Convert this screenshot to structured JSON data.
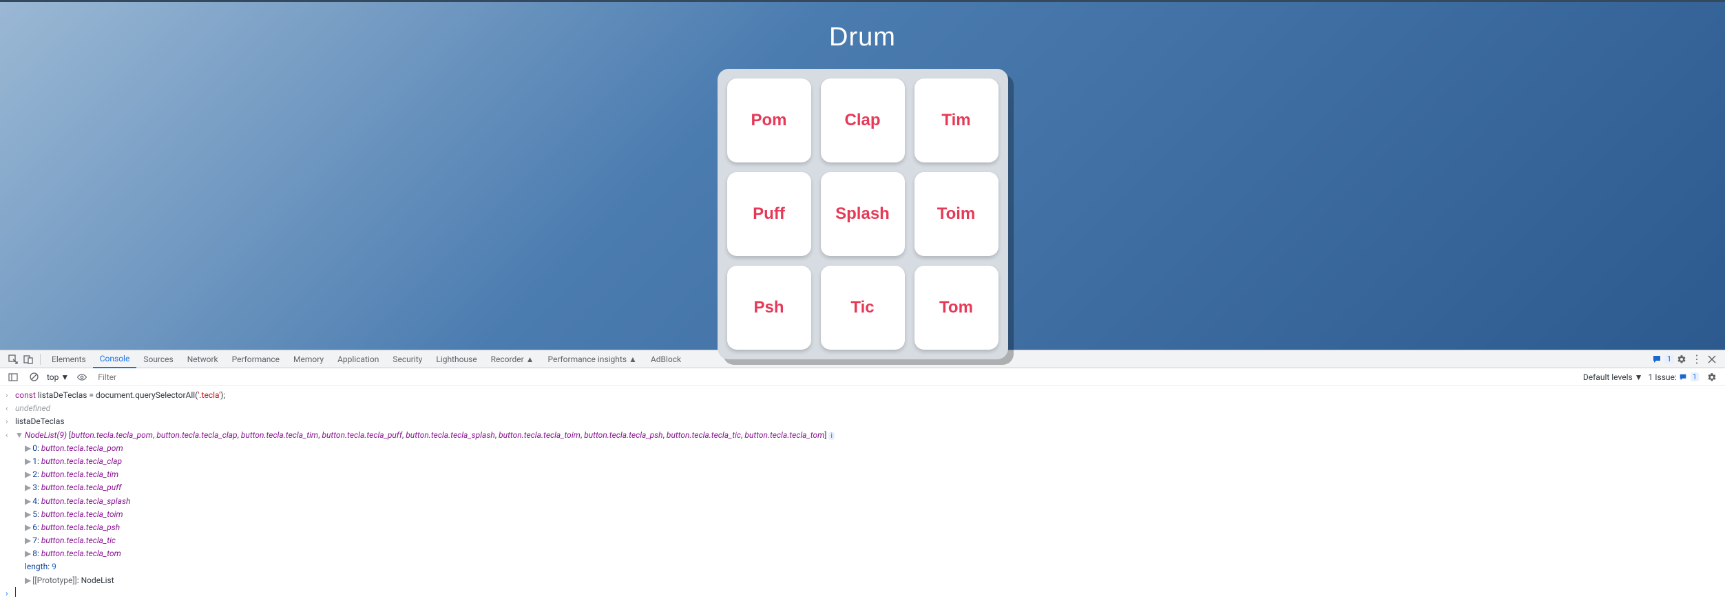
{
  "app": {
    "title": "Drum",
    "buttons": [
      "Pom",
      "Clap",
      "Tim",
      "Puff",
      "Splash",
      "Toim",
      "Psh",
      "Tic",
      "Tom"
    ]
  },
  "devtools": {
    "tabs": [
      "Elements",
      "Console",
      "Sources",
      "Network",
      "Performance",
      "Memory",
      "Application",
      "Security",
      "Lighthouse",
      "Recorder ▲",
      "Performance insights ▲",
      "AdBlock"
    ],
    "active_tab": "Console",
    "right_badge": "1",
    "toolbar": {
      "context": "top ▼",
      "filter_placeholder": "Filter",
      "levels": "Default levels ▼",
      "issue_label": "1 Issue:",
      "issue_badge": "1"
    },
    "console": {
      "input1_pre": "const listaDeTeclas = document.querySelectorAll(",
      "input1_str": "'.tecla'",
      "input1_post": ");",
      "undefined": "undefined",
      "input2": "listaDeTeclas",
      "nodelist_head": "NodeList(9)",
      "nodelist_items_inline": [
        "button.tecla.tecla_pom",
        "button.tecla.tecla_clap",
        "button.tecla.tecla_tim",
        "button.tecla.tecla_puff",
        "button.tecla.tecla_splash",
        "button.tecla.tecla_toim",
        "button.tecla.tecla_psh",
        "button.tecla.tecla_tic",
        "button.tecla.tecla_tom"
      ],
      "expanded": [
        {
          "idx": "0",
          "val": "button.tecla.tecla_pom"
        },
        {
          "idx": "1",
          "val": "button.tecla.tecla_clap"
        },
        {
          "idx": "2",
          "val": "button.tecla.tecla_tim"
        },
        {
          "idx": "3",
          "val": "button.tecla.tecla_puff"
        },
        {
          "idx": "4",
          "val": "button.tecla.tecla_splash"
        },
        {
          "idx": "5",
          "val": "button.tecla.tecla_toim"
        },
        {
          "idx": "6",
          "val": "button.tecla.tecla_psh"
        },
        {
          "idx": "7",
          "val": "button.tecla.tecla_tic"
        },
        {
          "idx": "8",
          "val": "button.tecla.tecla_tom"
        }
      ],
      "length_label": "length",
      "length_value": "9",
      "proto_label": "[[Prototype]]",
      "proto_value": "NodeList"
    }
  }
}
